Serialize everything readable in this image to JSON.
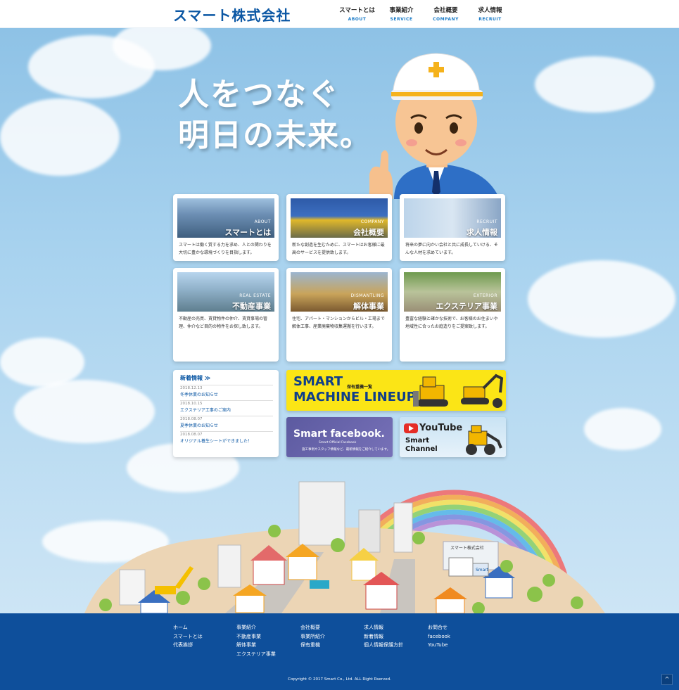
{
  "header": {
    "logo": "スマート株式会社",
    "nav": [
      {
        "jp": "スマートとは",
        "en": "ABOUT"
      },
      {
        "jp": "事業紹介",
        "en": "SERVICE"
      },
      {
        "jp": "会社概要",
        "en": "COMPANY"
      },
      {
        "jp": "求人情報",
        "en": "RECRUIT"
      }
    ]
  },
  "hero": {
    "line1": "人をつなぐ",
    "line2": "明日の未来。"
  },
  "cards": [
    {
      "en": "ABOUT",
      "jp": "スマートとは",
      "desc": "スマートは働く質する力を求め、人との関わりを大切に豊かな環境づくりを目指します。"
    },
    {
      "en": "COMPANY",
      "jp": "会社概要",
      "desc": "新たな創造を生むために、スマートはお客様に最高のサービスを提供致します。"
    },
    {
      "en": "RECRUIT",
      "jp": "求人情報",
      "desc": "将来の夢に向かい会社と共に成長していける、そんな人材を求めています。"
    },
    {
      "en": "REAL ESTATE",
      "jp": "不動産事業",
      "desc": "不動産の売買、賃貸物件の仲介、賃貸事場の管理、仲介など目的の物件をお探し致します。"
    },
    {
      "en": "DISMANTLING",
      "jp": "解体事業",
      "desc": "住宅、アパート・マンションからビル・工場まで解体工事、産業廃棄物収集運搬を行います。"
    },
    {
      "en": "EXTERIOR",
      "jp": "エクステリア事業",
      "desc": "豊富な経験と確かな技術で、お客様のお住まいや地域性に合ったお庭造りをご提案致します。"
    }
  ],
  "news": {
    "title": "新着情報 ≫",
    "items": [
      {
        "date": "2018.12.13",
        "text": "冬季休業のお知らせ"
      },
      {
        "date": "2018.10.15",
        "text": "エクステリア工事のご案内"
      },
      {
        "date": "2018.08.07",
        "text": "夏季休業のお知らせ"
      },
      {
        "date": "2018.08.07",
        "text": "オリジナル養生シートができました！"
      }
    ]
  },
  "banners": {
    "machine": {
      "title_line1": "SMART",
      "title_line2": "MACHINE LINEUP",
      "sub": "保有重機一覧"
    },
    "facebook": {
      "title": "Smart facebook.",
      "sub": "Smart Official Facebook",
      "desc": "施工事例やスタッフ情報など、最新情報をご紹介しています。"
    },
    "youtube": {
      "word": "YouTube",
      "line1": "Smart",
      "line2": "Channel"
    }
  },
  "town": {
    "sign": "スマート株式会社",
    "truck_label": "Smart"
  },
  "footer": {
    "col1": [
      "ホーム",
      "スマートとは",
      "代表挨拶"
    ],
    "col2": [
      "事業紹介",
      "不動産事業",
      "解体事業",
      "エクステリア事業"
    ],
    "col3": [
      "会社概要",
      "事業所紹介",
      "保有重機"
    ],
    "col4": [
      "求人情報",
      "新着情報",
      "個人情報保護方針"
    ],
    "col5": [
      "お問合せ",
      "facebook",
      "YouTube"
    ],
    "copyright": "Copyright © 2017 Smart Co., Ltd. ALL Right Rserved.",
    "pagetop": "^"
  },
  "colors": {
    "brand": "#0b57a4",
    "footer": "#0e4f9b",
    "machine_banner": "#fbe516",
    "facebook_banner": "#6a64ad"
  }
}
